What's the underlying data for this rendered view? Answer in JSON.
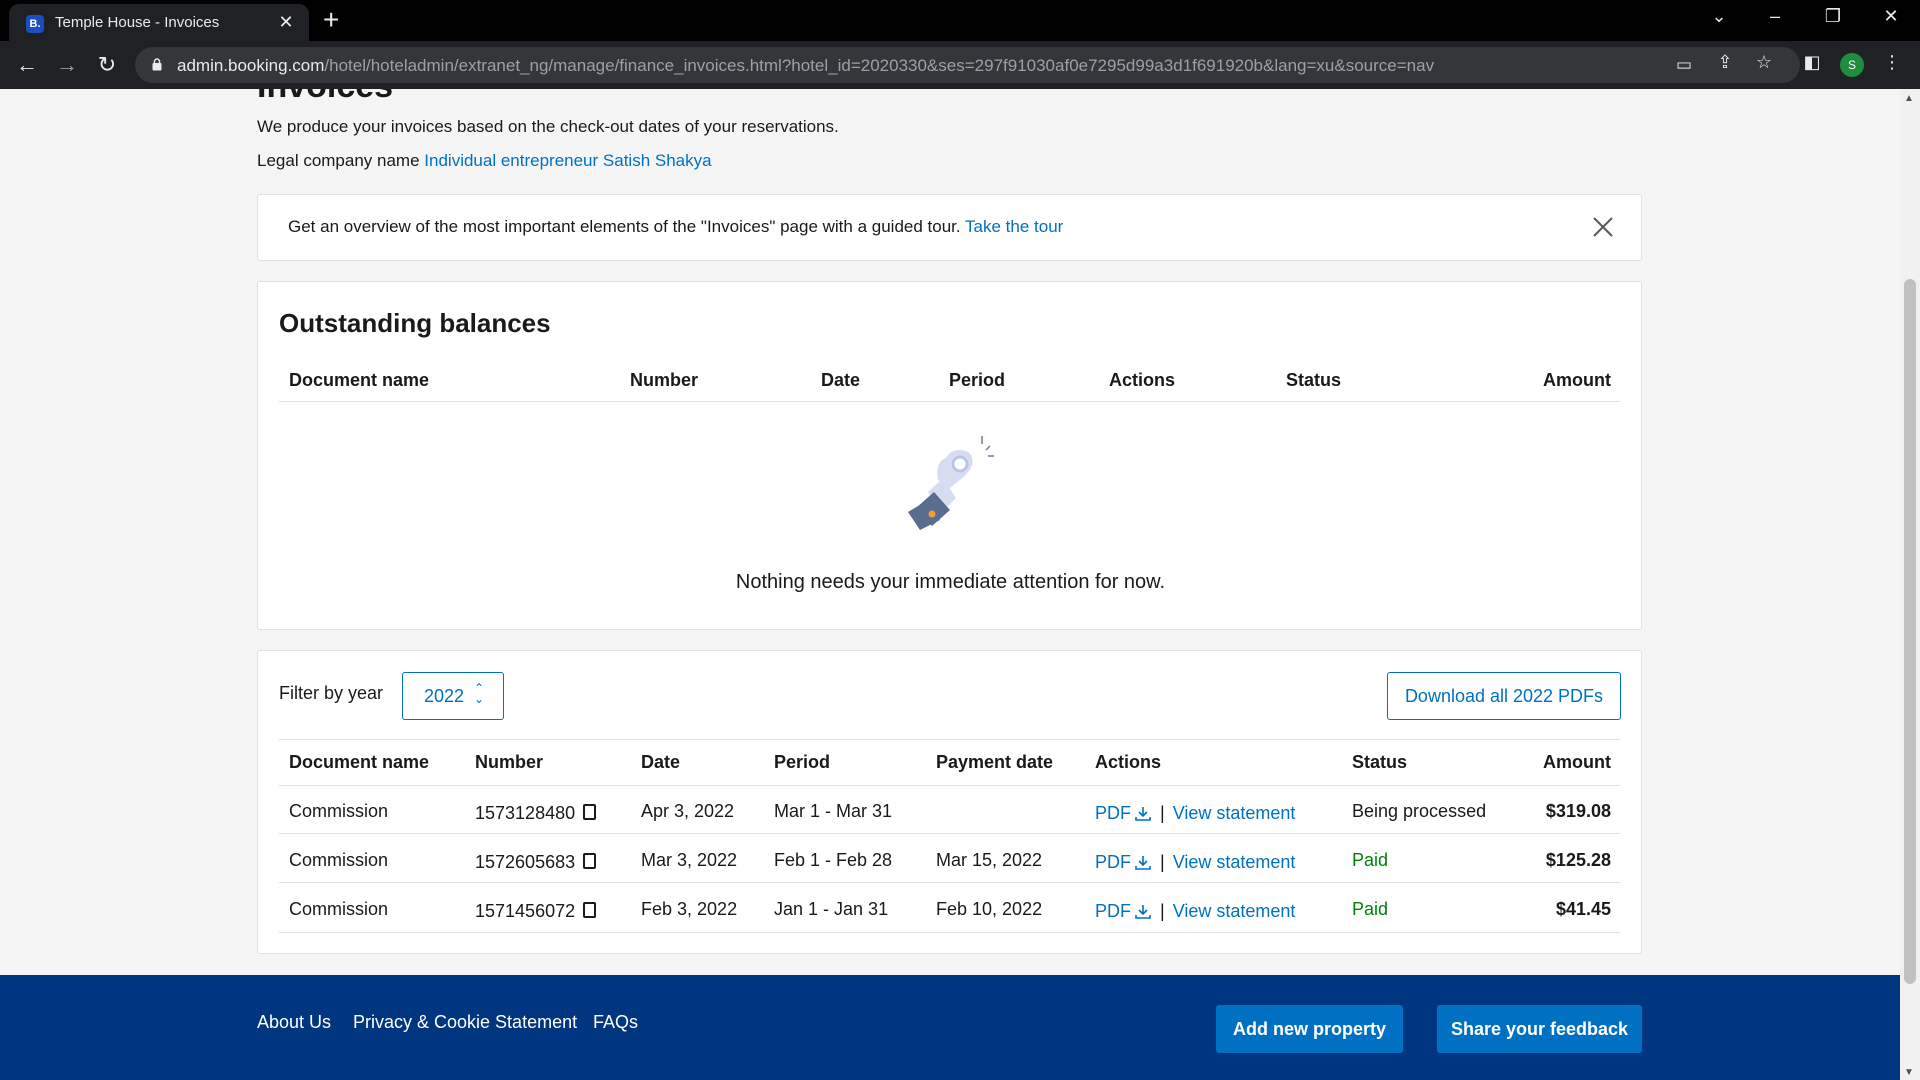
{
  "browser": {
    "tab_title": "Temple House - Invoices",
    "favicon_text": "B.",
    "url_host": "admin.booking.com",
    "url_path": "/hotel/hoteladmin/extranet_ng/manage/finance_invoices.html?hotel_id=2020330&ses=297f91030af0e7295d99a3d1f691920b&lang=xu&source=nav",
    "profile_initial": "S"
  },
  "page": {
    "title": "Invoices",
    "intro": "We produce your invoices based on the check-out dates of your reservations.",
    "legal_label": "Legal company name",
    "legal_name": "Individual entrepreneur Satish Shakya"
  },
  "tour": {
    "text": "Get an overview of the most important elements of the \"Invoices\" page with a guided tour.",
    "link": "Take the tour"
  },
  "outstanding": {
    "title": "Outstanding balances",
    "columns": [
      "Document name",
      "Number",
      "Date",
      "Period",
      "Actions",
      "Status",
      "Amount"
    ],
    "empty_text": "Nothing needs your immediate attention for now."
  },
  "invoices": {
    "filter_label": "Filter by year",
    "year": "2022",
    "download_all": "Download all 2022 PDFs",
    "columns": [
      "Document name",
      "Number",
      "Date",
      "Period",
      "Payment date",
      "Actions",
      "Status",
      "Amount"
    ],
    "pdf_label": "PDF",
    "view_statement_label": "View statement",
    "rows": [
      {
        "doc": "Commission",
        "number": "1573128480",
        "date": "Apr 3, 2022",
        "period": "Mar 1 - Mar 31",
        "payment_date": "",
        "status": "Being processed",
        "amount": "$319.08"
      },
      {
        "doc": "Commission",
        "number": "1572605683",
        "date": "Mar 3, 2022",
        "period": "Feb 1 - Feb 28",
        "payment_date": "Mar 15, 2022",
        "status": "Paid",
        "amount": "$125.28"
      },
      {
        "doc": "Commission",
        "number": "1571456072",
        "date": "Feb 3, 2022",
        "period": "Jan 1 - Jan 31",
        "payment_date": "Feb 10, 2022",
        "status": "Paid",
        "amount": "$41.45"
      }
    ]
  },
  "footer": {
    "links": [
      "About Us",
      "Privacy & Cookie Statement",
      "FAQs"
    ],
    "add_property": "Add new property",
    "feedback": "Share your feedback"
  },
  "colors": {
    "brand_dark": "#003580",
    "brand_link": "#0071c2",
    "paid_green": "#008009"
  }
}
